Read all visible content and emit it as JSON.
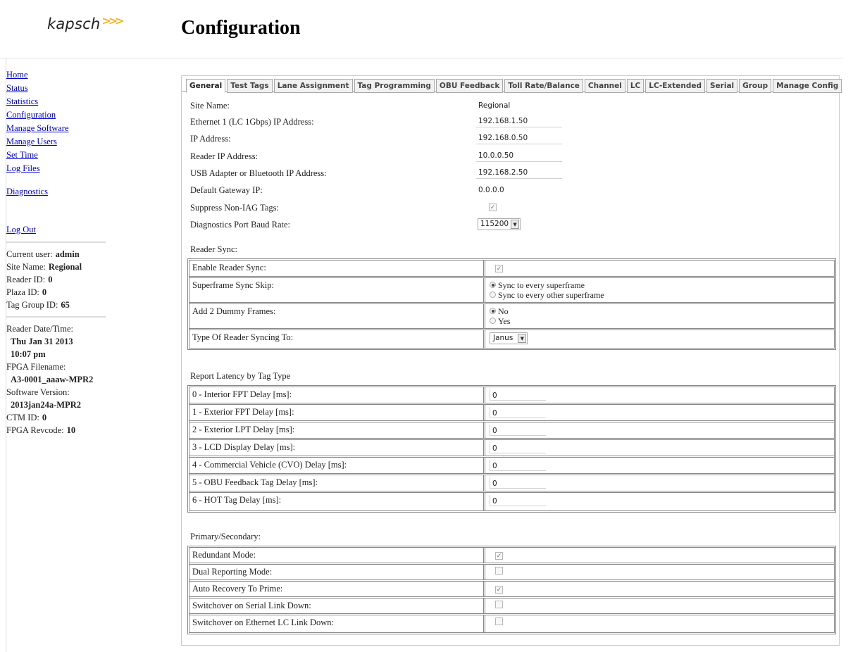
{
  "header": {
    "logo_text": "kapsch",
    "logo_mark": ">>>",
    "title": "Configuration"
  },
  "sidebar": {
    "nav": [
      "Home",
      "Status",
      "Statistics",
      "Configuration",
      "Manage Software",
      "Manage Users",
      "Set Time",
      "Log Files"
    ],
    "diagnostics": "Diagnostics",
    "logout": "Log Out",
    "info": {
      "current_user_label": "Current user:",
      "current_user": "admin",
      "site_name_label": "Site Name:",
      "site_name": "Regional",
      "reader_id_label": "Reader ID:",
      "reader_id": "0",
      "plaza_id_label": "Plaza ID:",
      "plaza_id": "0",
      "tag_group_id_label": "Tag Group ID:",
      "tag_group_id": "65",
      "reader_datetime_label": "Reader Date/Time:",
      "reader_date": "Thu Jan 31 2013",
      "reader_time": "10:07 pm",
      "fpga_filename_label": "FPGA Filename:",
      "fpga_filename": "A3-0001_aaaw-MPR2",
      "software_version_label": "Software Version:",
      "software_version": "2013jan24a-MPR2",
      "ctm_id_label": "CTM ID:",
      "ctm_id": "0",
      "fpga_revcode_label": "FPGA Revcode:",
      "fpga_revcode": "10"
    }
  },
  "tabs": [
    "General",
    "Test Tags",
    "Lane Assignment",
    "Tag Programming",
    "OBU Feedback",
    "Toll Rate/Balance",
    "Channel",
    "LC",
    "LC-Extended",
    "Serial",
    "Group",
    "Manage Config"
  ],
  "active_tab": "General",
  "general": {
    "site_name_label": "Site Name:",
    "site_name": "Regional",
    "eth1_label": "Ethernet 1 (LC 1Gbps) IP Address:",
    "eth1": "192.168.1.50",
    "ip_label": "IP Address:",
    "ip": "192.168.0.50",
    "reader_ip_label": "Reader IP Address:",
    "reader_ip": "10.0.0.50",
    "usb_label": "USB Adapter or Bluetooth IP Address:",
    "usb": "192.168.2.50",
    "gateway_label": "Default Gateway IP:",
    "gateway": "0.0.0.0",
    "suppress_label": "Suppress Non-IAG Tags:",
    "suppress_checked": true,
    "baud_label": "Diagnostics Port Baud Rate:",
    "baud": "115200"
  },
  "reader_sync": {
    "heading": "Reader Sync:",
    "enable_label": "Enable Reader Sync:",
    "enable_checked": true,
    "superframe_label": "Superframe Sync Skip:",
    "superframe_options": [
      "Sync to every superframe",
      "Sync to every other superframe"
    ],
    "superframe_selected": 0,
    "dummy_label": "Add 2 Dummy Frames:",
    "dummy_options": [
      "No",
      "Yes"
    ],
    "dummy_selected": 0,
    "type_label": "Type Of Reader Syncing To:",
    "type_value": "Janus"
  },
  "latency": {
    "heading": "Report Latency by Tag Type",
    "rows": [
      {
        "label": "0 - Interior FPT Delay [ms]:",
        "value": "0"
      },
      {
        "label": "1 - Exterior FPT Delay [ms]:",
        "value": "0"
      },
      {
        "label": "2 - Exterior LPT Delay [ms]:",
        "value": "0"
      },
      {
        "label": "3 - LCD Display Delay [ms]:",
        "value": "0"
      },
      {
        "label": "4 - Commercial Vehicle (CVO) Delay [ms]:",
        "value": "0"
      },
      {
        "label": "5 - OBU Feedback Tag Delay [ms]:",
        "value": "0"
      },
      {
        "label": "6 - HOT Tag Delay [ms]:",
        "value": "0"
      }
    ]
  },
  "primary_secondary": {
    "heading": "Primary/Secondary:",
    "rows": [
      {
        "label": "Redundant Mode:",
        "checked": true
      },
      {
        "label": "Dual Reporting Mode:",
        "checked": false
      },
      {
        "label": "Auto Recovery To Prime:",
        "checked": true
      },
      {
        "label": "Switchover on Serial Link Down:",
        "checked": false
      },
      {
        "label": "Switchover on Ethernet LC Link Down:",
        "checked": false
      }
    ]
  },
  "glyphs": {
    "check": "✓",
    "dropdown_arrow": "▼"
  }
}
